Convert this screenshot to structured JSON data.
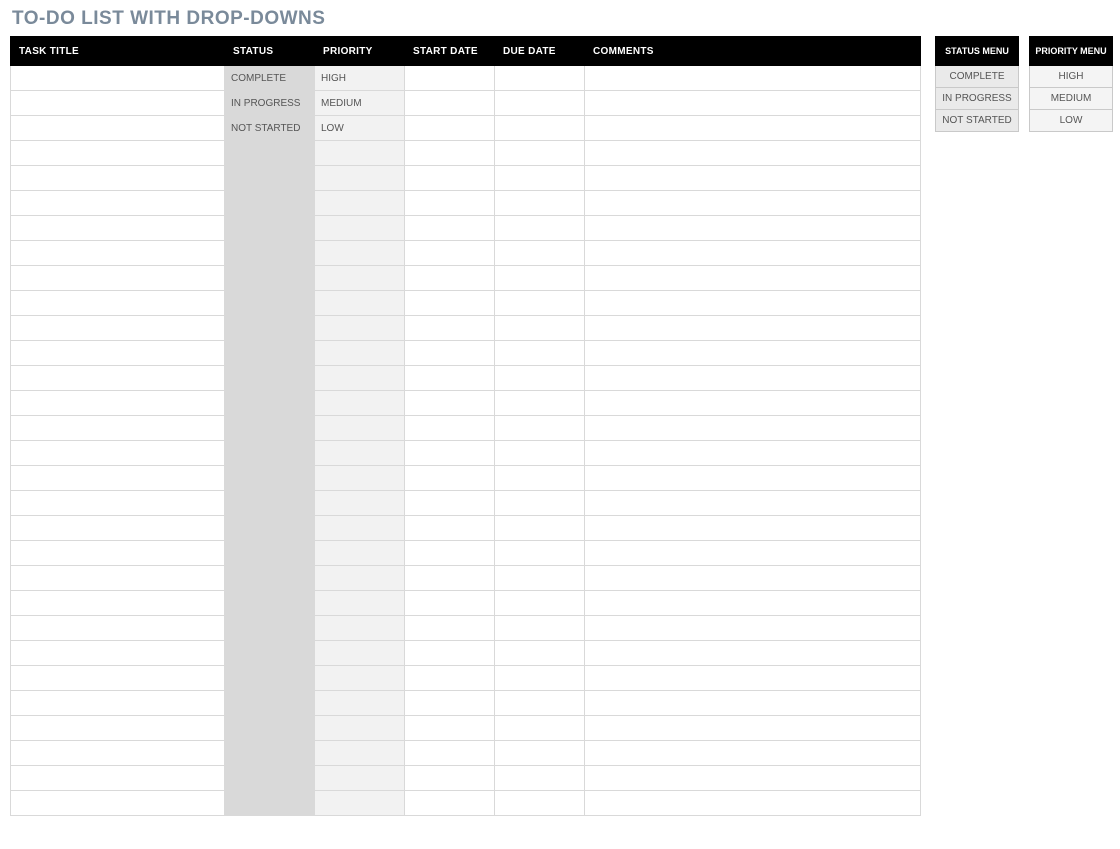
{
  "title": "TO-DO LIST WITH DROP-DOWNS",
  "columns": {
    "task": "TASK TITLE",
    "status": "STATUS",
    "priority": "PRIORITY",
    "start": "START DATE",
    "due": "DUE DATE",
    "comments": "COMMENTS"
  },
  "col_widths": {
    "task": 214,
    "status": 90,
    "priority": 90,
    "start": 90,
    "due": 90,
    "comments": 336
  },
  "rows": [
    {
      "task": "",
      "status": "COMPLETE",
      "priority": "HIGH",
      "start": "",
      "due": "",
      "comments": ""
    },
    {
      "task": "",
      "status": "IN PROGRESS",
      "priority": "MEDIUM",
      "start": "",
      "due": "",
      "comments": ""
    },
    {
      "task": "",
      "status": "NOT STARTED",
      "priority": "LOW",
      "start": "",
      "due": "",
      "comments": ""
    },
    {
      "task": "",
      "status": "",
      "priority": "",
      "start": "",
      "due": "",
      "comments": ""
    },
    {
      "task": "",
      "status": "",
      "priority": "",
      "start": "",
      "due": "",
      "comments": ""
    },
    {
      "task": "",
      "status": "",
      "priority": "",
      "start": "",
      "due": "",
      "comments": ""
    },
    {
      "task": "",
      "status": "",
      "priority": "",
      "start": "",
      "due": "",
      "comments": ""
    },
    {
      "task": "",
      "status": "",
      "priority": "",
      "start": "",
      "due": "",
      "comments": ""
    },
    {
      "task": "",
      "status": "",
      "priority": "",
      "start": "",
      "due": "",
      "comments": ""
    },
    {
      "task": "",
      "status": "",
      "priority": "",
      "start": "",
      "due": "",
      "comments": ""
    },
    {
      "task": "",
      "status": "",
      "priority": "",
      "start": "",
      "due": "",
      "comments": ""
    },
    {
      "task": "",
      "status": "",
      "priority": "",
      "start": "",
      "due": "",
      "comments": ""
    },
    {
      "task": "",
      "status": "",
      "priority": "",
      "start": "",
      "due": "",
      "comments": ""
    },
    {
      "task": "",
      "status": "",
      "priority": "",
      "start": "",
      "due": "",
      "comments": ""
    },
    {
      "task": "",
      "status": "",
      "priority": "",
      "start": "",
      "due": "",
      "comments": ""
    },
    {
      "task": "",
      "status": "",
      "priority": "",
      "start": "",
      "due": "",
      "comments": ""
    },
    {
      "task": "",
      "status": "",
      "priority": "",
      "start": "",
      "due": "",
      "comments": ""
    },
    {
      "task": "",
      "status": "",
      "priority": "",
      "start": "",
      "due": "",
      "comments": ""
    },
    {
      "task": "",
      "status": "",
      "priority": "",
      "start": "",
      "due": "",
      "comments": ""
    },
    {
      "task": "",
      "status": "",
      "priority": "",
      "start": "",
      "due": "",
      "comments": ""
    },
    {
      "task": "",
      "status": "",
      "priority": "",
      "start": "",
      "due": "",
      "comments": ""
    },
    {
      "task": "",
      "status": "",
      "priority": "",
      "start": "",
      "due": "",
      "comments": ""
    },
    {
      "task": "",
      "status": "",
      "priority": "",
      "start": "",
      "due": "",
      "comments": ""
    },
    {
      "task": "",
      "status": "",
      "priority": "",
      "start": "",
      "due": "",
      "comments": ""
    },
    {
      "task": "",
      "status": "",
      "priority": "",
      "start": "",
      "due": "",
      "comments": ""
    },
    {
      "task": "",
      "status": "",
      "priority": "",
      "start": "",
      "due": "",
      "comments": ""
    },
    {
      "task": "",
      "status": "",
      "priority": "",
      "start": "",
      "due": "",
      "comments": ""
    },
    {
      "task": "",
      "status": "",
      "priority": "",
      "start": "",
      "due": "",
      "comments": ""
    },
    {
      "task": "",
      "status": "",
      "priority": "",
      "start": "",
      "due": "",
      "comments": ""
    },
    {
      "task": "",
      "status": "",
      "priority": "",
      "start": "",
      "due": "",
      "comments": ""
    }
  ],
  "status_menu": {
    "header": "STATUS MENU",
    "options": [
      "COMPLETE",
      "IN PROGRESS",
      "NOT STARTED"
    ]
  },
  "priority_menu": {
    "header": "PRIORITY MENU",
    "options": [
      "HIGH",
      "MEDIUM",
      "LOW"
    ]
  }
}
